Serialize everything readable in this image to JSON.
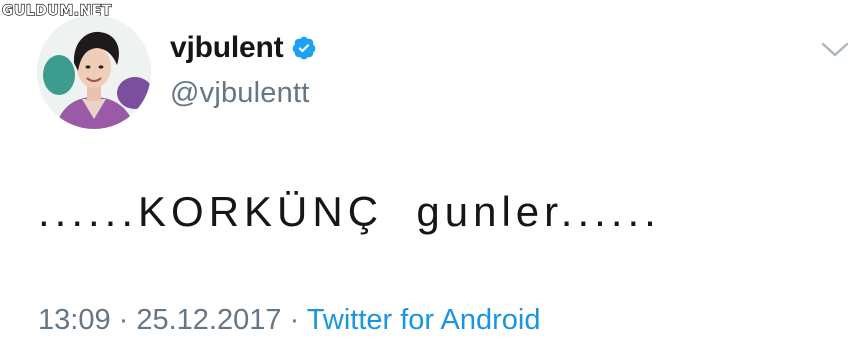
{
  "watermark": "GULDUM.NET",
  "author": {
    "display_name": "vjbulent",
    "handle": "@vjbulentt",
    "verified": true,
    "verified_icon": "verified-badge-icon"
  },
  "tweet": {
    "text": "......KORKÜNÇ  gunler......"
  },
  "meta": {
    "time": "13:09",
    "separator": " · ",
    "date": "25.12.2017",
    "source": "Twitter for Android"
  },
  "menu_icon": "chevron-down-icon",
  "colors": {
    "text": "#14171a",
    "secondary": "#657786",
    "link": "#1b95e0",
    "verified": "#1da1f2"
  }
}
